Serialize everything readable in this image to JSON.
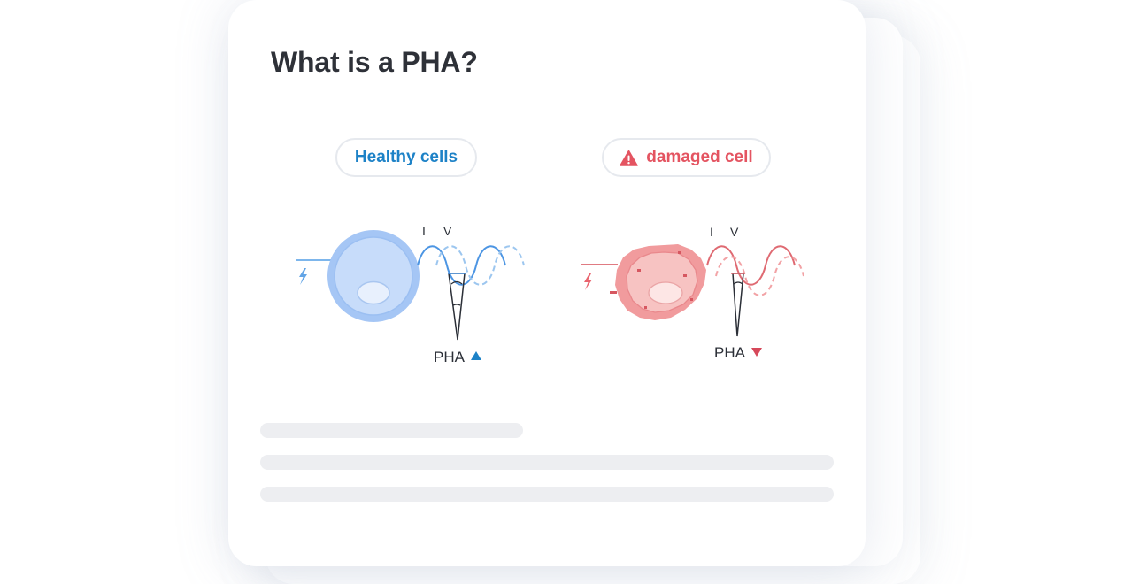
{
  "card": {
    "title": "What is a PHA?"
  },
  "healthy": {
    "pill_label": "Healthy cells",
    "current_label": "I",
    "voltage_label": "V",
    "pha_label": "PHA",
    "pha_trend": "up",
    "accent_color": "#1d82c7"
  },
  "damaged": {
    "pill_label": "damaged cell",
    "pill_icon": "warning-triangle-icon",
    "current_label": "I",
    "voltage_label": "V",
    "pha_label": "PHA",
    "pha_trend": "down",
    "accent_color": "#e45461"
  }
}
